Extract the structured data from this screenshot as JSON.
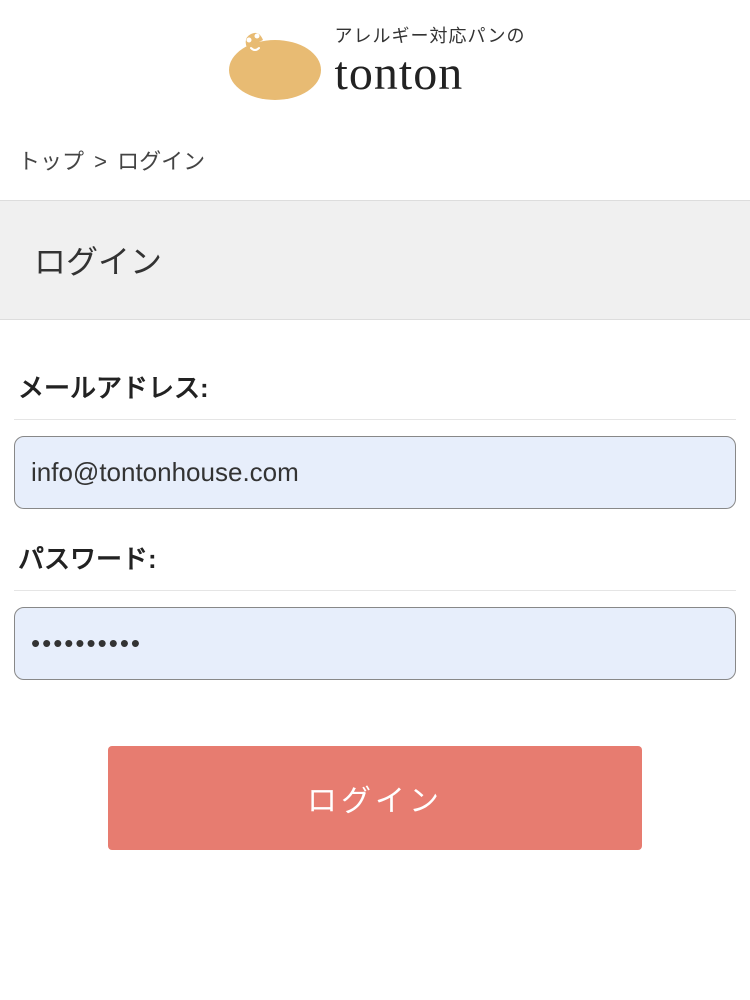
{
  "header": {
    "tagline": "アレルギー対応パンの",
    "brand": "tonton"
  },
  "breadcrumb": {
    "home": "トップ",
    "separator": ">",
    "current": "ログイン"
  },
  "section": {
    "title": "ログイン"
  },
  "form": {
    "email_label": "メールアドレス:",
    "email_value": "info@tontonhouse.com",
    "password_label": "パスワード:",
    "password_value": "••••••••••",
    "submit_label": "ログイン"
  },
  "colors": {
    "accent": "#e77c70",
    "input_bg": "#e7eefb",
    "logo_gold": "#e8bb73"
  }
}
